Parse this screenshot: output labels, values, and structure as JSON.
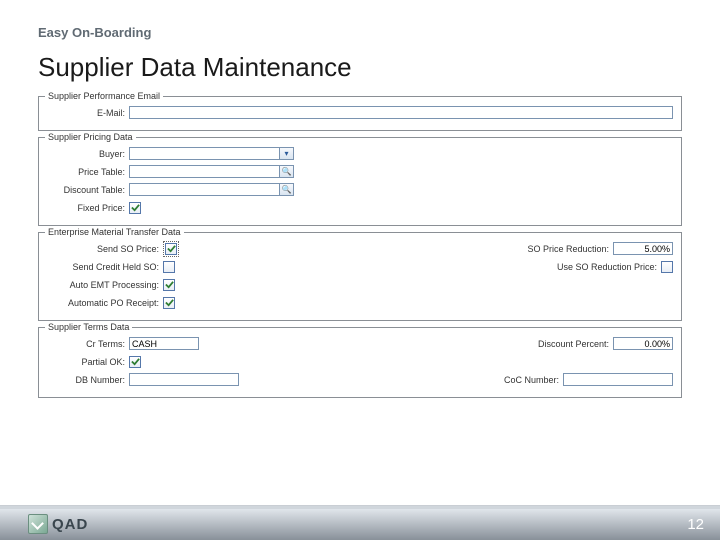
{
  "kicker": "Easy On-Boarding",
  "title": "Supplier Data Maintenance",
  "box1": {
    "legend": "Supplier Performance Email",
    "email_lbl": "E-Mail:"
  },
  "box2": {
    "legend": "Supplier Pricing Data",
    "buyer_lbl": "Buyer:",
    "price_table_lbl": "Price Table:",
    "discount_table_lbl": "Discount Table:",
    "fixed_price_lbl": "Fixed Price:"
  },
  "box3": {
    "legend": "Enterprise Material Transfer Data",
    "send_so_price_lbl": "Send SO Price:",
    "send_credit_held_so_lbl": "Send Credit Held SO:",
    "auto_emt_lbl": "Auto EMT Processing:",
    "auto_po_receipt_lbl": "Automatic PO Receipt:",
    "so_price_reduction_lbl": "SO Price Reduction:",
    "so_price_reduction_val": "5.00%",
    "use_so_reduction_lbl": "Use SO Reduction Price:"
  },
  "box4": {
    "legend": "Supplier Terms Data",
    "cr_terms_lbl": "Cr Terms:",
    "cr_terms_val": "CASH",
    "partial_ok_lbl": "Partial OK:",
    "db_number_lbl": "DB Number:",
    "discount_percent_lbl": "Discount Percent:",
    "discount_percent_val": "0.00%",
    "coc_number_lbl": "CoC Number:"
  },
  "footer": {
    "brand": "QAD",
    "page": "12"
  }
}
